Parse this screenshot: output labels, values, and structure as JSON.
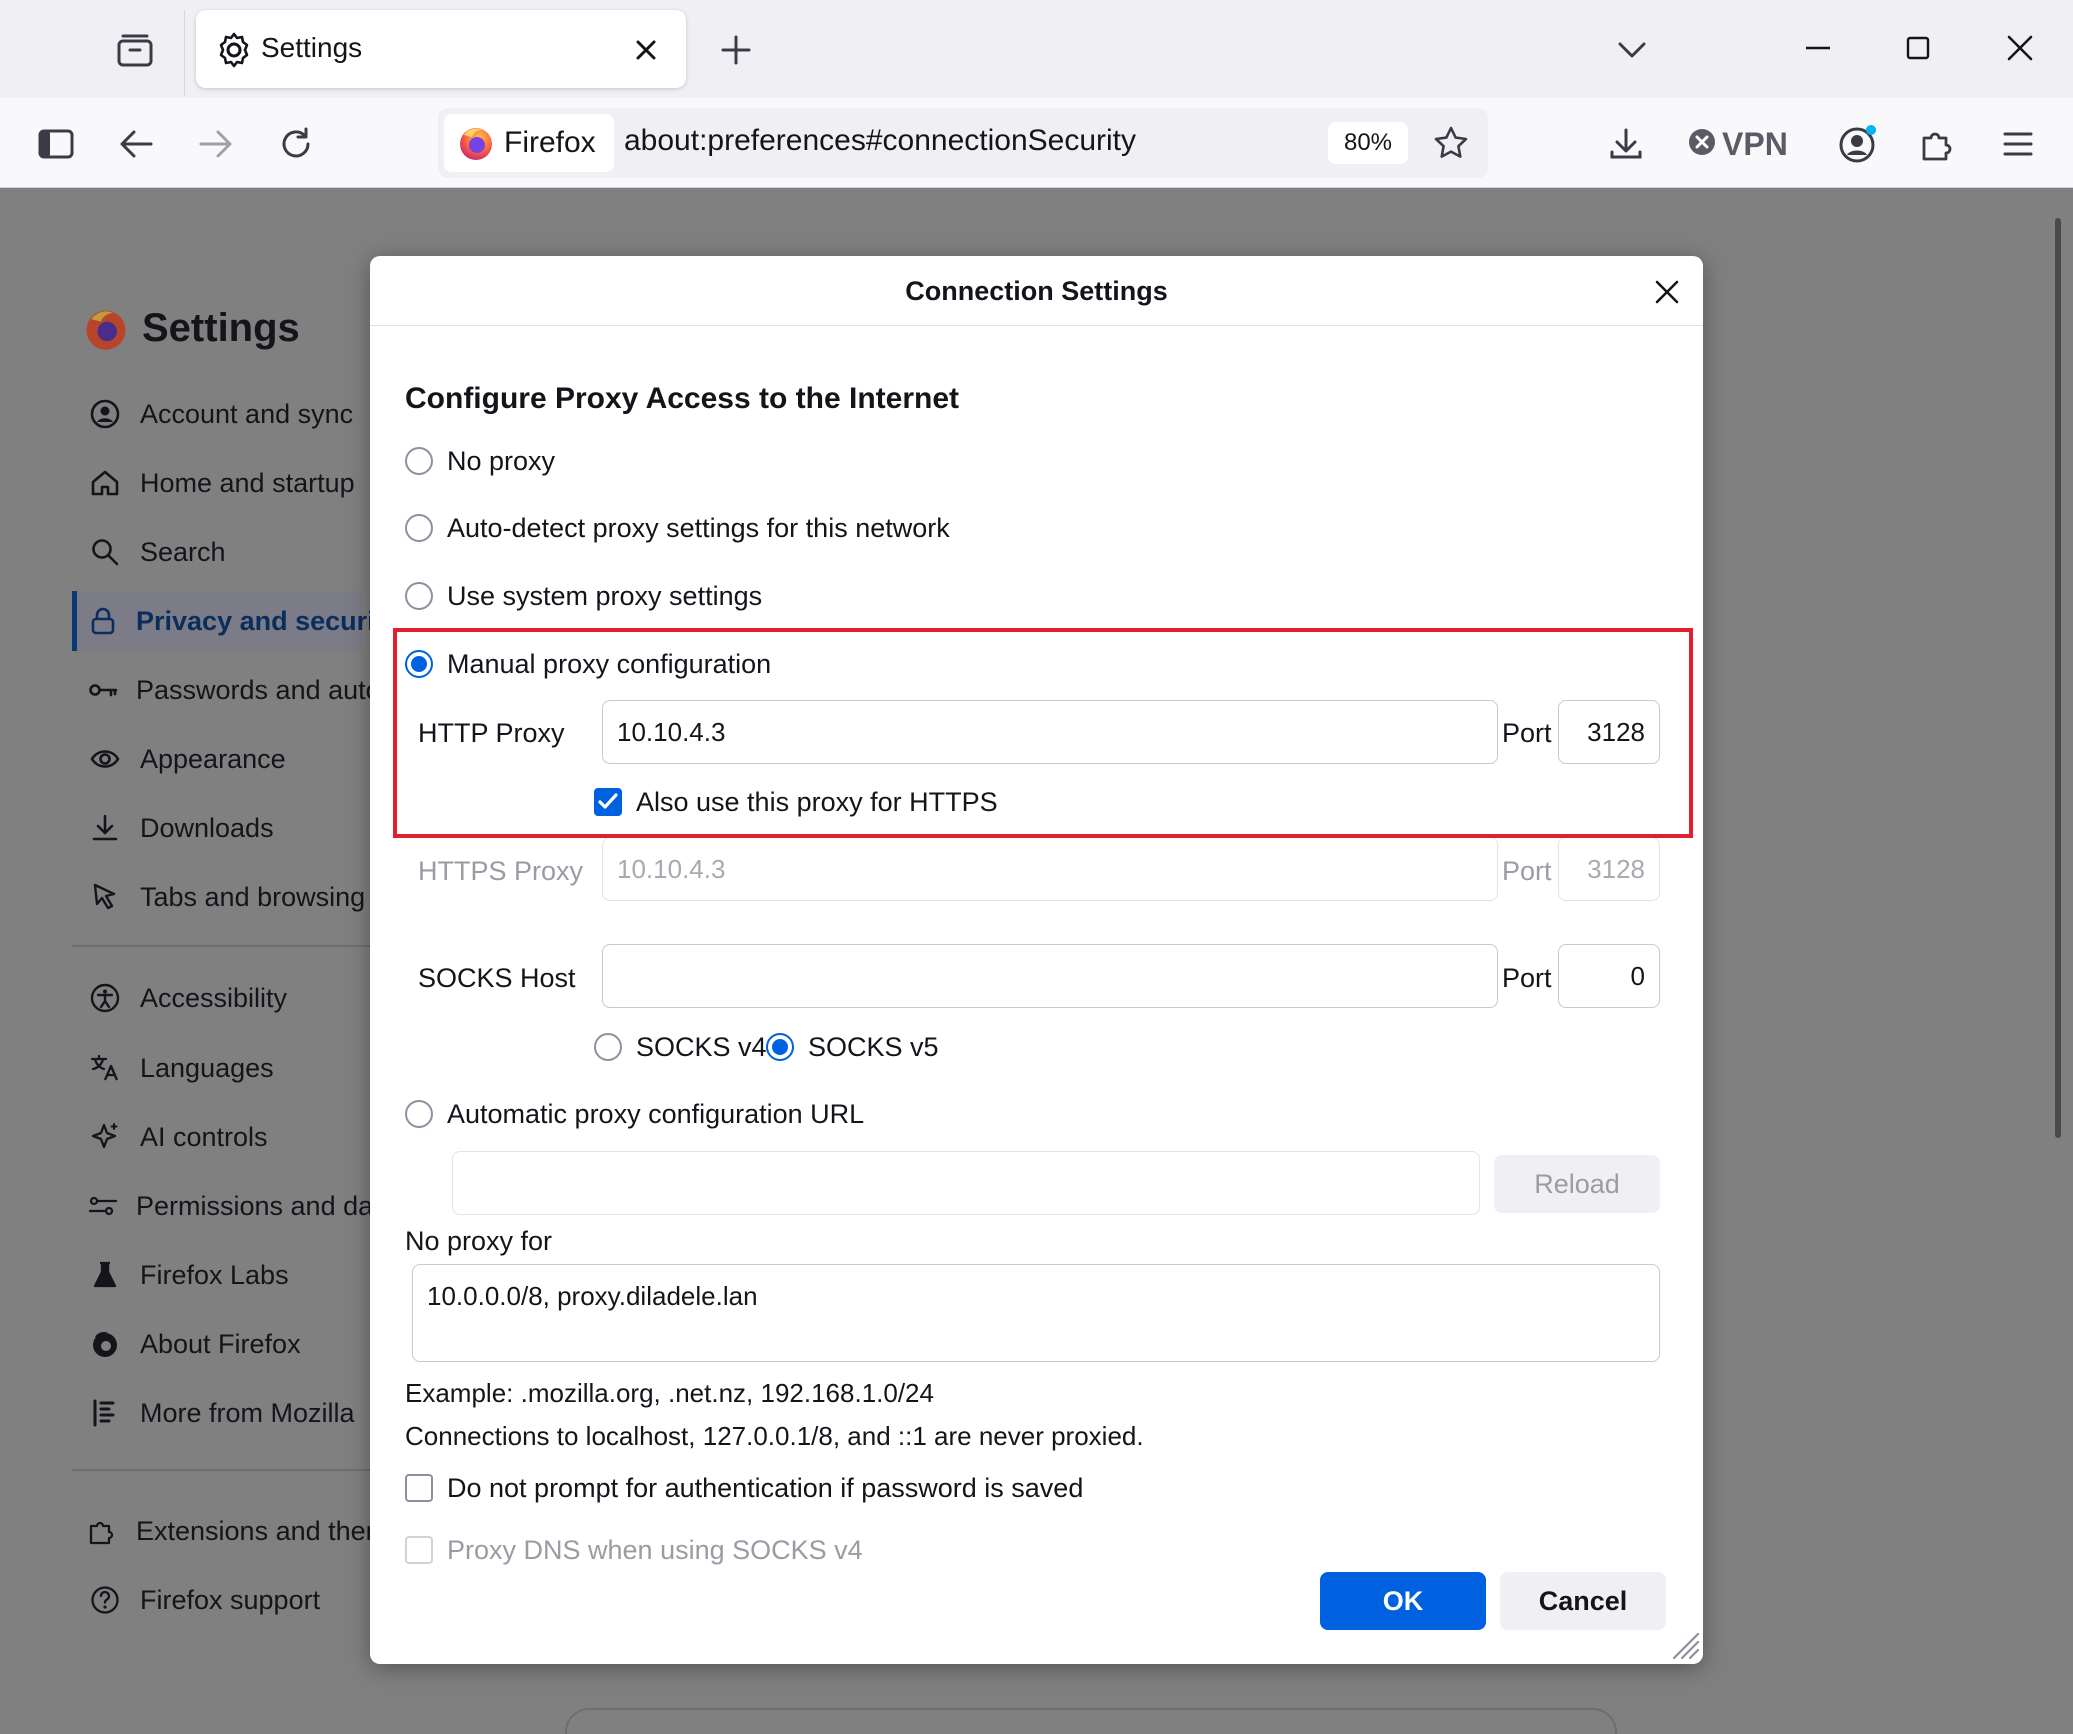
{
  "browser": {
    "tab": {
      "title": "Settings"
    },
    "urlbar": {
      "identity_label": "Firefox",
      "url": "about:preferences#connectionSecurity",
      "zoom": "80%"
    },
    "vpn_label": "VPN",
    "icons": {
      "tab_list": "tab-list-icon",
      "new_tab": "plus-icon",
      "overflow": "chevron-down-icon",
      "sidebar": "sidebar-icon",
      "back": "back-arrow-icon",
      "forward": "forward-arrow-icon",
      "reload": "reload-icon",
      "bookmark": "star-icon",
      "downloads": "download-icon",
      "account": "account-icon",
      "extensions": "puzzle-icon",
      "menu": "hamburger-menu-icon"
    },
    "accent": "#0061e0"
  },
  "page": {
    "title": "Settings",
    "sidebar": {
      "items": [
        {
          "label": "Account and sync",
          "icon": "account-circle-icon"
        },
        {
          "label": "Home and startup",
          "icon": "home-icon"
        },
        {
          "label": "Search",
          "icon": "search-icon"
        },
        {
          "label": "Privacy and security",
          "icon": "lock-icon"
        },
        {
          "label": "Passwords and autofill",
          "icon": "key-icon"
        },
        {
          "label": "Appearance",
          "icon": "eye-icon"
        },
        {
          "label": "Downloads",
          "icon": "download-icon"
        },
        {
          "label": "Tabs and browsing",
          "icon": "cursor-icon"
        },
        {
          "label": "Accessibility",
          "icon": "accessibility-icon"
        },
        {
          "label": "Languages",
          "icon": "translate-icon"
        },
        {
          "label": "AI controls",
          "icon": "sparkle-icon"
        },
        {
          "label": "Permissions and data",
          "icon": "sliders-icon"
        },
        {
          "label": "Firefox Labs",
          "icon": "flask-icon"
        },
        {
          "label": "About Firefox",
          "icon": "firefox-icon"
        },
        {
          "label": "More from Mozilla",
          "icon": "mozilla-icon"
        },
        {
          "label": "Extensions and themes",
          "icon": "puzzle-icon"
        },
        {
          "label": "Firefox support",
          "icon": "help-icon"
        }
      ],
      "active_index": 3
    }
  },
  "dialog": {
    "title": "Connection Settings",
    "section_title": "Configure Proxy Access to the Internet",
    "options": {
      "no_proxy": "No proxy",
      "auto_detect": "Auto-detect proxy settings for this network",
      "system": "Use system proxy settings",
      "manual": "Manual proxy configuration",
      "auto_url": "Automatic proxy configuration URL"
    },
    "selected_option": "manual",
    "http_proxy": {
      "label": "HTTP Proxy",
      "value": "10.10.4.3",
      "port_label": "Port",
      "port": "3128"
    },
    "also_https": {
      "label": "Also use this proxy for HTTPS",
      "checked": true
    },
    "https_proxy": {
      "label": "HTTPS Proxy",
      "value": "10.10.4.3",
      "port_label": "Port",
      "port": "3128"
    },
    "socks": {
      "label": "SOCKS Host",
      "value": "",
      "port_label": "Port",
      "port": "0",
      "v4": "SOCKS v4",
      "v5": "SOCKS v5",
      "selected": "v5"
    },
    "auto_url": {
      "value": "",
      "reload": "Reload"
    },
    "no_proxy_for": {
      "label": "No proxy for",
      "value": "10.0.0.0/8, proxy.diladele.lan"
    },
    "example": "Example: .mozilla.org, .net.nz, 192.168.1.0/24",
    "localhost_note": "Connections to localhost, 127.0.0.1/8, and ::1 are never proxied.",
    "no_auth_prompt": {
      "label": "Do not prompt for authentication if password is saved",
      "checked": false
    },
    "proxy_dns": {
      "label": "Proxy DNS when using SOCKS v4",
      "checked": false
    },
    "ok": "OK",
    "cancel": "Cancel",
    "highlight_color": "#e0202c"
  }
}
